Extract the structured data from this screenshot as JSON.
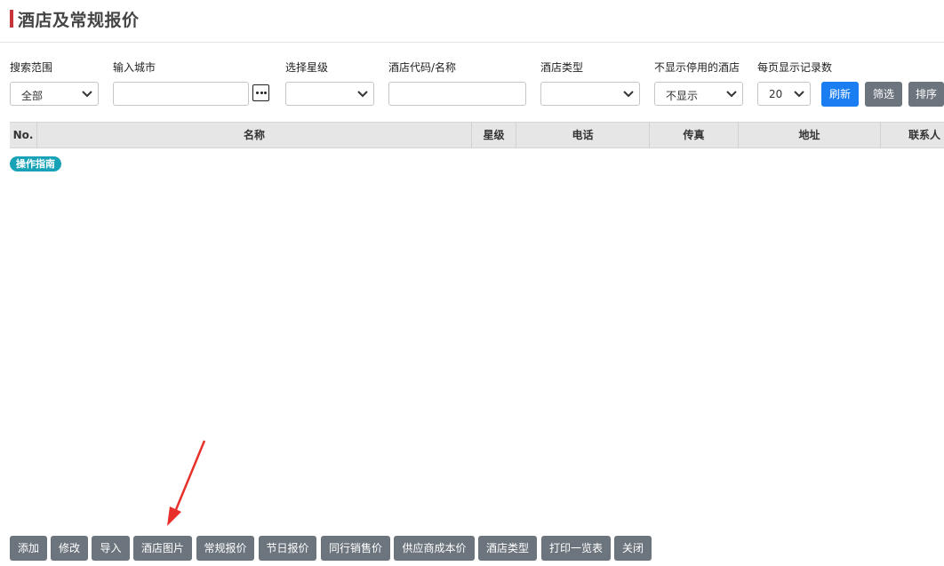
{
  "header": {
    "title": "酒店及常规报价"
  },
  "filters": {
    "scope": {
      "label": "搜索范围",
      "value": "全部"
    },
    "city": {
      "label": "输入城市",
      "value": ""
    },
    "star": {
      "label": "选择星级",
      "value": ""
    },
    "code_name": {
      "label": "酒店代码/名称",
      "value": ""
    },
    "hotel_type": {
      "label": "酒店类型",
      "value": ""
    },
    "hide_disabled": {
      "label": "不显示停用的酒店",
      "value": "不显示"
    },
    "page_size": {
      "label": "每页显示记录数",
      "value": "20"
    }
  },
  "toolbar": {
    "refresh": "刷新",
    "filter": "筛选",
    "sort": "排序"
  },
  "table": {
    "columns": [
      "No.",
      "名称",
      "星级",
      "电话",
      "传真",
      "地址",
      "联系人"
    ]
  },
  "guide_badge": "操作指南",
  "bottom_buttons": [
    "添加",
    "修改",
    "导入",
    "酒店图片",
    "常规报价",
    "节日报价",
    "同行销售价",
    "供应商成本价",
    "酒店类型",
    "打印一览表",
    "关闭"
  ],
  "colors": {
    "accent_bar": "#c7343a",
    "primary": "#1a7ef2",
    "gray_button": "#6c757d",
    "badge": "#17a2b8",
    "arrow": "#e8302a"
  }
}
